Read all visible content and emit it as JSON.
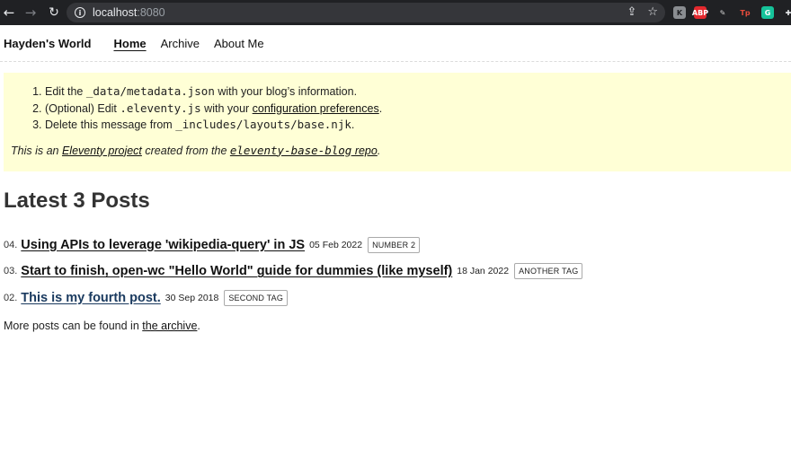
{
  "browser": {
    "url_host": "localhost",
    "url_port": ":8080",
    "back_glyph": "←",
    "forward_glyph": "→",
    "reload_glyph": "↻",
    "info_glyph": "i",
    "share_glyph": "⇪",
    "star_glyph": "☆",
    "extensions": [
      {
        "icon": "k-extension-icon",
        "text": "K",
        "color": "#8a8d91",
        "fg": "#202124"
      },
      {
        "icon": "adblock-icon",
        "text": "ABP",
        "color": "#e3292e",
        "fg": "#ffffff"
      },
      {
        "icon": "pen-extension-icon",
        "text": "✎",
        "color": "#202124",
        "fg": "#d0d0d0"
      },
      {
        "icon": "tp-extension-icon",
        "text": "Tp",
        "color": "#202124",
        "fg": "#e74c3c"
      },
      {
        "icon": "grammarly-icon",
        "text": "G",
        "color": "#15c39a",
        "fg": "#ffffff"
      },
      {
        "icon": "puzzle-icon",
        "text": "✚",
        "color": "#202124",
        "fg": "#e8eaed"
      }
    ]
  },
  "header": {
    "site_title": "Hayden's World",
    "nav": [
      {
        "label": "Home",
        "active": true
      },
      {
        "label": "Archive",
        "active": false
      },
      {
        "label": "About Me",
        "active": false
      }
    ]
  },
  "warning": {
    "item1_pre": "Edit the ",
    "item1_code": "_data/metadata.json",
    "item1_post": " with your blog’s information.",
    "item2_pre": "(Optional) Edit ",
    "item2_code": ".eleventy.js",
    "item2_mid": " with your ",
    "item2_link": "configuration preferences",
    "item2_post": ".",
    "item3_pre": "Delete this message from ",
    "item3_code": "_includes/layouts/base.njk",
    "item3_post": ".",
    "note_pre": "This is an ",
    "note_link1": "Eleventy project",
    "note_mid": " created from the ",
    "note_link2_code": "eleventy-base-blog",
    "note_link2_text": " repo",
    "note_post": "."
  },
  "main": {
    "title": "Latest 3 Posts",
    "posts": [
      {
        "num": "04.",
        "title": "Using APIs to leverage 'wikipedia-query' in JS",
        "date": "05 Feb 2022",
        "tag": "NUMBER 2",
        "visited": false
      },
      {
        "num": "03.",
        "title": "Start to finish, open-wc \"Hello World\" guide for dummies (like myself)",
        "date": "18 Jan 2022",
        "tag": "ANOTHER TAG",
        "visited": false
      },
      {
        "num": "02.",
        "title": "This is my fourth post.",
        "date": "30 Sep 2018",
        "tag": "SECOND TAG",
        "visited": true
      }
    ],
    "more_pre": "More posts can be found in ",
    "more_link": "the archive",
    "more_post": "."
  }
}
